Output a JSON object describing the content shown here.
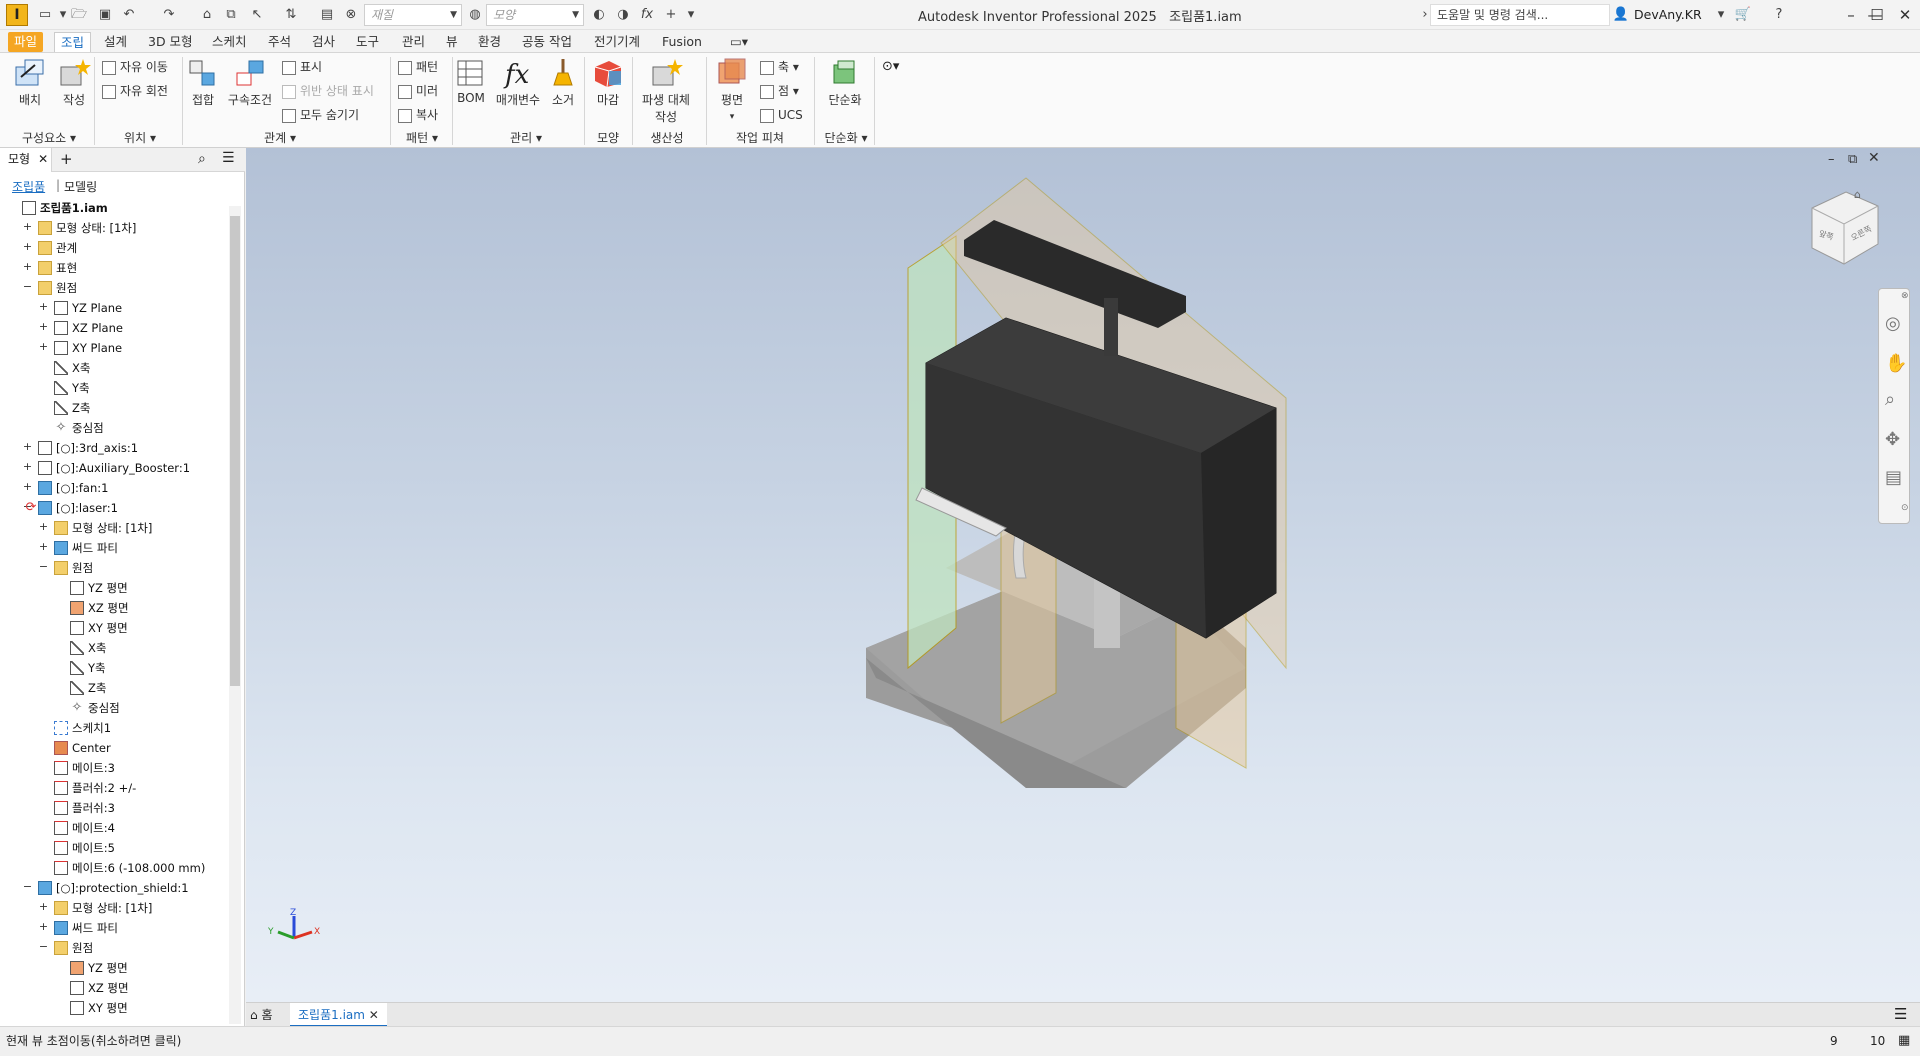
{
  "titlebar": {
    "app_icon": "I",
    "appearance_placeholder": "재질",
    "appearance2_placeholder": "모양",
    "title": "Autodesk Inventor Professional 2025",
    "document": "조립품1.iam",
    "search_placeholder": "도움말 및 명령 검색...",
    "user": "DevAny.KR"
  },
  "tabs": [
    "파일",
    "조립",
    "설계",
    "3D 모형",
    "스케치",
    "주석",
    "검사",
    "도구",
    "관리",
    "뷰",
    "환경",
    "공동 작업",
    "전기기계",
    "Fusion"
  ],
  "ribbon": {
    "component": {
      "place": "배치",
      "create": "작성",
      "group": "구성요소"
    },
    "position": {
      "free_move": "자유 이동",
      "free_rotate": "자유 회전",
      "group": "위치"
    },
    "relations": {
      "joint": "접합",
      "constraint": "구속조건",
      "show": "표시",
      "show_sick": "위반 상태 표시",
      "hide_all": "모두 숨기기",
      "group": "관계"
    },
    "pattern": {
      "pattern": "패턴",
      "mirror": "미러",
      "copy": "복사",
      "group": "패턴"
    },
    "manage": {
      "bom": "BOM",
      "params": "매개변수",
      "purge": "소거",
      "group": "관리"
    },
    "appearance": {
      "finish": "마감",
      "group": "모양"
    },
    "productivity": {
      "derived": "파생 대체",
      "derived2": "작성",
      "group": "생산성"
    },
    "work_features": {
      "plane": "평면",
      "axis": "축",
      "point": "점",
      "ucs": "UCS",
      "group": "작업 피쳐"
    },
    "simplification": {
      "simplify": "단순화",
      "group": "단순화"
    }
  },
  "browser": {
    "tab": "모형",
    "sub_assembly": "조립품",
    "sub_modeling": "모델링",
    "tree": [
      {
        "label": "조립품1.iam",
        "indent": 0,
        "icon": "comp",
        "toggle": "",
        "bold": true
      },
      {
        "label": "모형 상태: [1차]",
        "indent": 1,
        "icon": "folder",
        "toggle": "+"
      },
      {
        "label": "관계",
        "indent": 1,
        "icon": "folder",
        "toggle": "+"
      },
      {
        "label": "표현",
        "indent": 1,
        "icon": "folder",
        "toggle": "+"
      },
      {
        "label": "원점",
        "indent": 1,
        "icon": "folder",
        "toggle": "−"
      },
      {
        "label": "YZ Plane",
        "indent": 2,
        "icon": "plane",
        "toggle": "+"
      },
      {
        "label": "XZ Plane",
        "indent": 2,
        "icon": "plane",
        "toggle": "+"
      },
      {
        "label": "XY Plane",
        "indent": 2,
        "icon": "plane",
        "toggle": "+"
      },
      {
        "label": "X축",
        "indent": 2,
        "icon": "axis",
        "toggle": ""
      },
      {
        "label": "Y축",
        "indent": 2,
        "icon": "axis",
        "toggle": ""
      },
      {
        "label": "Z축",
        "indent": 2,
        "icon": "axis",
        "toggle": ""
      },
      {
        "label": "중심점",
        "indent": 2,
        "icon": "pt",
        "toggle": ""
      },
      {
        "label": "[○]:3rd_axis:1",
        "indent": 1,
        "icon": "comp",
        "toggle": "+"
      },
      {
        "label": "[○]:Auxiliary_Booster:1",
        "indent": 1,
        "icon": "comp",
        "toggle": "+"
      },
      {
        "label": "[○]:fan:1",
        "indent": 1,
        "icon": "part",
        "toggle": "+"
      },
      {
        "label": "[○]:laser:1",
        "indent": 1,
        "icon": "part",
        "toggle": "−",
        "refresh": true
      },
      {
        "label": "모형 상태: [1차]",
        "indent": 2,
        "icon": "folder",
        "toggle": "+"
      },
      {
        "label": "써드 파티",
        "indent": 2,
        "icon": "part",
        "toggle": "+"
      },
      {
        "label": "원점",
        "indent": 2,
        "icon": "folder",
        "toggle": "−"
      },
      {
        "label": "YZ 평면",
        "indent": 3,
        "icon": "plane",
        "toggle": ""
      },
      {
        "label": "XZ 평면",
        "indent": 3,
        "icon": "planeo",
        "toggle": ""
      },
      {
        "label": "XY 평면",
        "indent": 3,
        "icon": "plane",
        "toggle": ""
      },
      {
        "label": "X축",
        "indent": 3,
        "icon": "axis",
        "toggle": ""
      },
      {
        "label": "Y축",
        "indent": 3,
        "icon": "axis",
        "toggle": ""
      },
      {
        "label": "Z축",
        "indent": 3,
        "icon": "axis",
        "toggle": ""
      },
      {
        "label": "중심점",
        "indent": 3,
        "icon": "pt",
        "toggle": ""
      },
      {
        "label": "스케치1",
        "indent": 2,
        "icon": "sk",
        "toggle": ""
      },
      {
        "label": "Center",
        "indent": 2,
        "icon": "ctr",
        "toggle": ""
      },
      {
        "label": "메이트:3",
        "indent": 2,
        "icon": "constr",
        "toggle": ""
      },
      {
        "label": "플러쉬:2 +/-",
        "indent": 2,
        "icon": "constr",
        "toggle": ""
      },
      {
        "label": "플러쉬:3",
        "indent": 2,
        "icon": "constr",
        "toggle": ""
      },
      {
        "label": "메이트:4",
        "indent": 2,
        "icon": "constr",
        "toggle": ""
      },
      {
        "label": "메이트:5",
        "indent": 2,
        "icon": "constr",
        "toggle": ""
      },
      {
        "label": "메이트:6 (-108.000 mm)",
        "indent": 2,
        "icon": "constr",
        "toggle": ""
      },
      {
        "label": "[○]:protection_shield:1",
        "indent": 1,
        "icon": "part",
        "toggle": "−"
      },
      {
        "label": "모형 상태: [1차]",
        "indent": 2,
        "icon": "folder",
        "toggle": "+"
      },
      {
        "label": "써드 파티",
        "indent": 2,
        "icon": "part",
        "toggle": "+"
      },
      {
        "label": "원점",
        "indent": 2,
        "icon": "folder",
        "toggle": "−"
      },
      {
        "label": "YZ 평면",
        "indent": 3,
        "icon": "planeo",
        "toggle": ""
      },
      {
        "label": "XZ 평면",
        "indent": 3,
        "icon": "plane",
        "toggle": ""
      },
      {
        "label": "XY 평면",
        "indent": 3,
        "icon": "plane",
        "toggle": ""
      }
    ]
  },
  "doctabs": {
    "home": "홈",
    "doc": "조립품1.iam"
  },
  "status": {
    "message": "현재 뷰 초점이동(취소하려면 클릭)",
    "n1": "9",
    "n2": "10"
  },
  "viewcube": {
    "face1": "앞쪽",
    "face2": "오른쪽"
  },
  "triad": {
    "x": "X",
    "y": "Y",
    "z": "Z"
  }
}
